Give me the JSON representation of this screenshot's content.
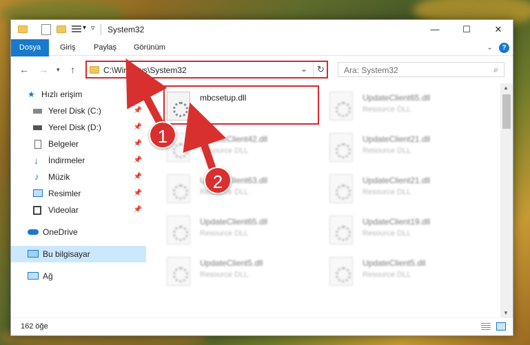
{
  "window": {
    "title": "System32",
    "controls": {
      "minimize": "—",
      "maximize": "☐",
      "close": "✕"
    }
  },
  "ribbon": {
    "tabs": [
      "Dosya",
      "Giriş",
      "Paylaş",
      "Görünüm"
    ],
    "help": "?",
    "expand": "⌄"
  },
  "address": {
    "path": "C:\\Windows\\System32",
    "search_placeholder": "Ara: System32"
  },
  "nav": {
    "items": [
      {
        "label": "Hızlı erişim",
        "icon": "star-icon"
      },
      {
        "label": "Yerel Disk (C:)",
        "icon": "drive-icon",
        "pinned": true
      },
      {
        "label": "Yerel Disk (D:)",
        "icon": "drive-icon",
        "pinned": true
      },
      {
        "label": "Belgeler",
        "icon": "documents-icon",
        "pinned": true
      },
      {
        "label": "İndirmeler",
        "icon": "download-icon",
        "pinned": true
      },
      {
        "label": "Müzik",
        "icon": "music-icon",
        "pinned": true
      },
      {
        "label": "Resimler",
        "icon": "pictures-icon",
        "pinned": true
      },
      {
        "label": "Videolar",
        "icon": "videos-icon",
        "pinned": true
      },
      {
        "label": "OneDrive",
        "icon": "cloud-icon"
      },
      {
        "label": "Bu bilgisayar",
        "icon": "computer-icon",
        "selected": true
      },
      {
        "label": "Ağ",
        "icon": "network-icon"
      }
    ]
  },
  "files": [
    {
      "name": "mbcsetup.dll",
      "type": ""
    },
    {
      "name": "UpdateClient65.dll",
      "type": "Resource DLL"
    },
    {
      "name": "UpdateClient42.dll",
      "type": "Resource DLL"
    },
    {
      "name": "UpdateClient21.dll",
      "type": "Resource DLL"
    },
    {
      "name": "UpdateClient63.dll",
      "type": "Resource DLL"
    },
    {
      "name": "UpdateClient21.dll",
      "type": "Resource DLL"
    },
    {
      "name": "UpdateClient65.dll",
      "type": "Resource DLL"
    },
    {
      "name": "UpdateClient19.dll",
      "type": "Resource DLL"
    },
    {
      "name": "UpdateClient5.dll",
      "type": "Resource DLL"
    },
    {
      "name": "UpdateClient5.dll",
      "type": "Resource DLL"
    }
  ],
  "status": {
    "count": "162 öğe"
  },
  "annotations": {
    "step1": "1",
    "step2": "2"
  },
  "colors": {
    "accent": "#1979ca",
    "highlight": "#d9262c",
    "selected": "#cce8ff"
  }
}
